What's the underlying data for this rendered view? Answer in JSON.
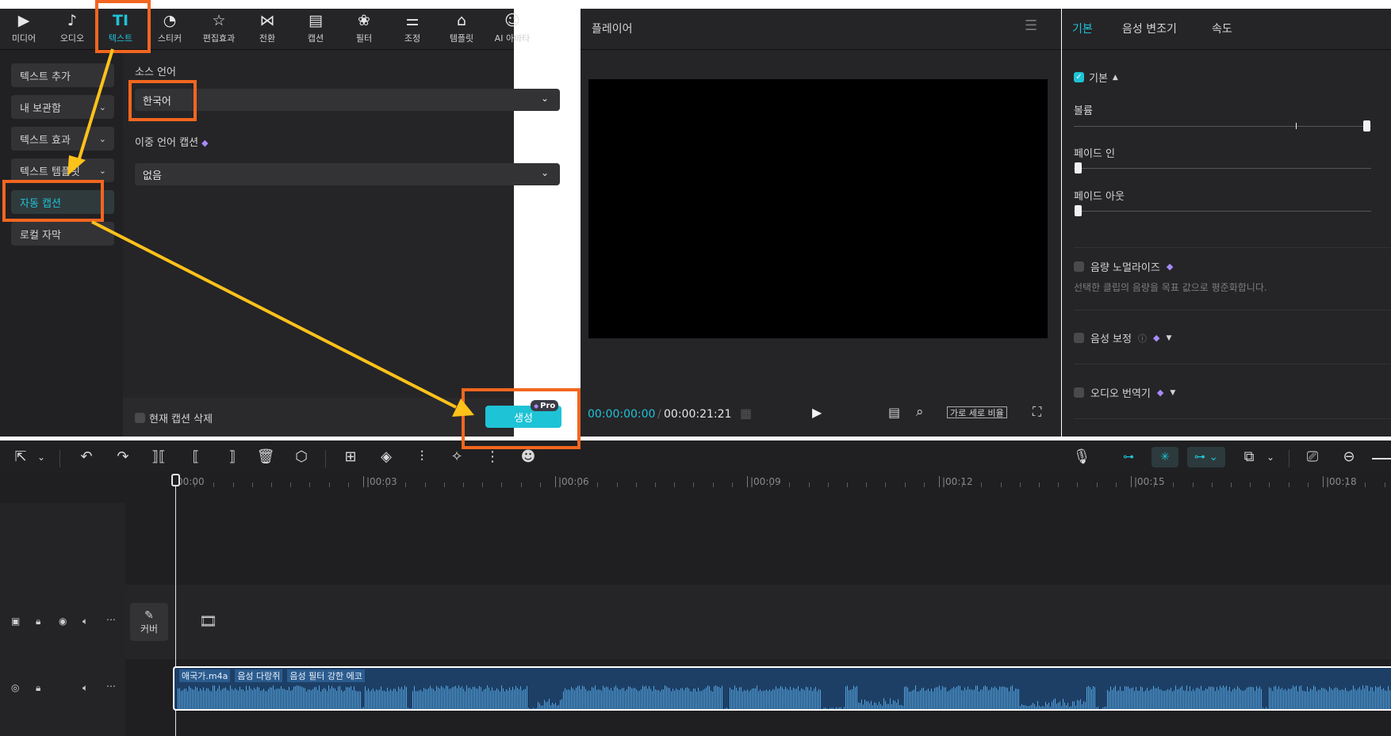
{
  "toolbar": {
    "items": [
      {
        "label": "미디어",
        "icon": "media-icon",
        "glyph": "▶"
      },
      {
        "label": "오디오",
        "icon": "audio-icon",
        "glyph": "♪"
      },
      {
        "label": "텍스트",
        "icon": "text-icon",
        "glyph": "TI"
      },
      {
        "label": "스티커",
        "icon": "sticker-icon",
        "glyph": "◔"
      },
      {
        "label": "편집효과",
        "icon": "effects-icon",
        "glyph": "☆"
      },
      {
        "label": "전환",
        "icon": "transition-icon",
        "glyph": "⋈"
      },
      {
        "label": "캡션",
        "icon": "caption-icon",
        "glyph": "▤"
      },
      {
        "label": "필터",
        "icon": "filter-icon",
        "glyph": "❀"
      },
      {
        "label": "조정",
        "icon": "adjust-icon",
        "glyph": "⚌"
      },
      {
        "label": "템플릿",
        "icon": "template-icon",
        "glyph": "⌂"
      },
      {
        "label": "AI 아바타",
        "icon": "ai-avatar-icon",
        "glyph": "☺"
      }
    ],
    "active_index": 2
  },
  "sidebar": {
    "items": [
      {
        "label": "텍스트 추가",
        "chevron": false
      },
      {
        "label": "내 보관함",
        "chevron": true
      },
      {
        "label": "텍스트 효과",
        "chevron": true
      },
      {
        "label": "텍스트 템플릿",
        "chevron": true
      },
      {
        "label": "자동 캡션",
        "chevron": false
      },
      {
        "label": "로컬 자막",
        "chevron": false
      }
    ],
    "active_index": 4
  },
  "caption_panel": {
    "source_language_label": "소스 언어",
    "source_language_value": "한국어",
    "bilingual_label": "이중 언어 캡션",
    "bilingual_value": "없음",
    "delete_label": "현재 캡션 삭제",
    "generate_label": "생성",
    "pro_badge": "Pro"
  },
  "player": {
    "title": "플레이어",
    "current_time": "00:00:00:00",
    "separator": "/",
    "total_time": "00:00:21:21",
    "ratio_label": "가로 세로 비율"
  },
  "right_panel": {
    "tabs": [
      "기본",
      "음성 변조기",
      "속도"
    ],
    "active_tab": 0,
    "basic_section": "기본",
    "volume_label": "볼륨",
    "fade_in_label": "페이드 인",
    "fade_out_label": "페이드 아웃",
    "normalize_label": "음량 노멀라이즈",
    "normalize_desc": "선택한 클립의 음량을 목표 값으로 평준화합니다.",
    "voice_enhance_label": "음성 보정",
    "audio_translator_label": "오디오 번역기",
    "volume_level": 1.0,
    "fade_in_level": 0,
    "fade_out_level": 0
  },
  "timeline": {
    "ticks": [
      "00:00",
      "|00:03",
      "|00:06",
      "|00:09",
      "|00:12",
      "|00:15",
      "|00:18"
    ],
    "cover_label": "커버",
    "clip_name": "애국가.m4a",
    "clip_tags": [
      "음성 다랑쥐",
      "음성 필터 강한 에코"
    ]
  },
  "colors": {
    "accent": "#1fc3d6",
    "highlight": "#f2661f",
    "arrow": "#ffc21a",
    "clip": "#1d3f66"
  }
}
